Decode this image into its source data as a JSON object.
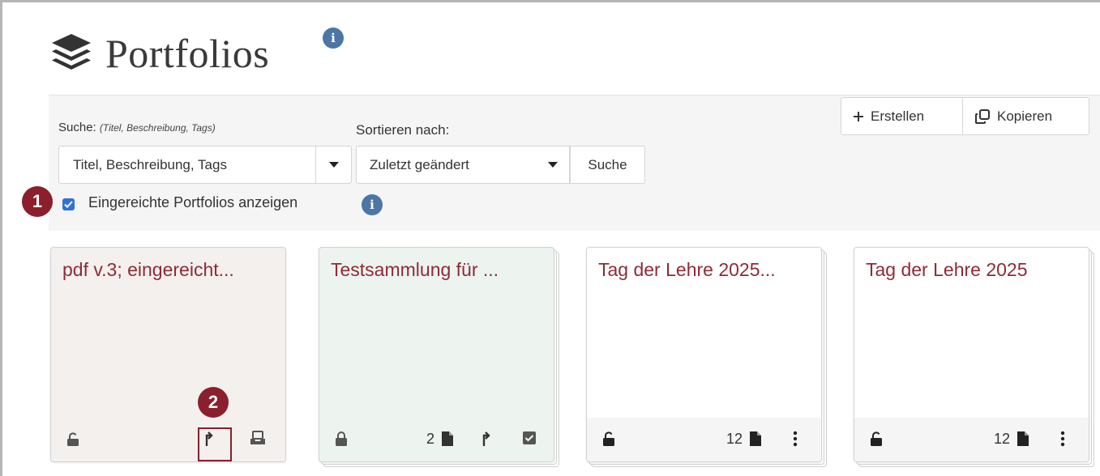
{
  "header": {
    "title": "Portfolios"
  },
  "filters": {
    "search_label": "Suche:",
    "search_hint": "(Titel, Beschreibung, Tags)",
    "search_value": "Titel, Beschreibung, Tags",
    "sort_label": "Sortieren nach:",
    "sort_value": "Zuletzt geändert",
    "search_button": "Suche",
    "show_submitted_label": "Eingereichte Portfolios anzeigen",
    "show_submitted_checked": true
  },
  "toolbar": {
    "create_label": "Erstellen",
    "copy_label": "Kopieren"
  },
  "annotations": {
    "badge_1": "1",
    "badge_2": "2",
    "badge_color": "#8b1f2d"
  },
  "cards": [
    {
      "title": "pdf v.3; eingereicht...",
      "background": "#f4f0ee",
      "lock": "unlocked",
      "icons": [
        "submit-icon",
        "inbox-icon"
      ]
    },
    {
      "title": "Testsammlung für ...",
      "background": "#edf3ef",
      "lock": "locked",
      "page_count": "2",
      "icons": [
        "page-icon",
        "submit-icon",
        "checkbox-icon"
      ]
    },
    {
      "title": "Tag der Lehre 2025...",
      "background": "#ffffff",
      "lock": "unlocked",
      "page_count": "12",
      "icons": [
        "page-icon",
        "kebab-icon"
      ]
    },
    {
      "title": "Tag der Lehre 2025",
      "background": "#ffffff",
      "lock": "unlocked",
      "page_count": "12",
      "icons": [
        "page-icon",
        "kebab-icon"
      ]
    }
  ],
  "colors": {
    "accent_title": "#8e2b36",
    "info_blue": "#4b76a6",
    "checkbox_blue": "#2d73d6"
  }
}
